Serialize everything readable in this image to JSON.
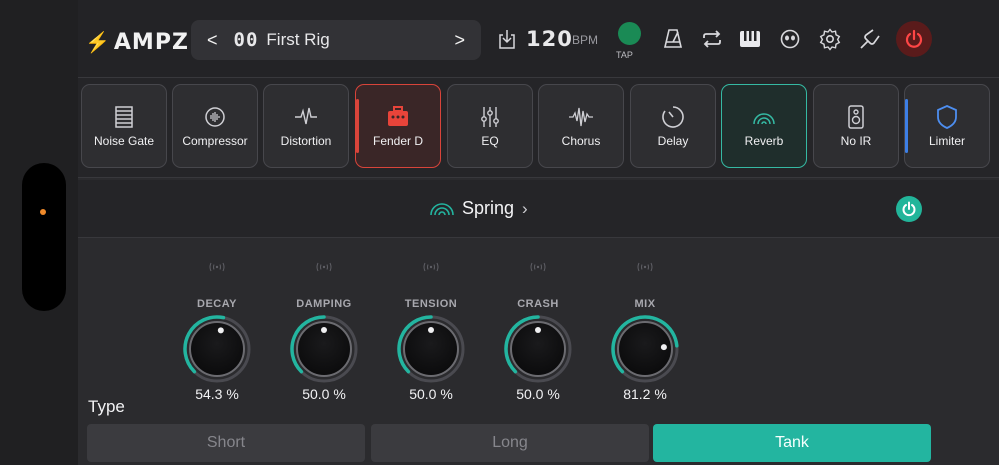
{
  "app": {
    "brand": "AMPZ"
  },
  "rig": {
    "prev_glyph": "<",
    "number": "00",
    "name": "First Rig",
    "next_glyph": ">"
  },
  "tempo": {
    "value": "120",
    "unit": "BPM",
    "tap_label": "TAP"
  },
  "toolbar_icons": [
    "metronome-icon",
    "loop-icon",
    "piano-icon",
    "tuner-face-icon",
    "settings-icon",
    "tuning-fork-icon",
    "power-icon"
  ],
  "modules": [
    {
      "label": "Noise Gate",
      "icon": "noise-gate-icon",
      "state": "normal"
    },
    {
      "label": "Compressor",
      "icon": "compressor-icon",
      "state": "normal"
    },
    {
      "label": "Distortion",
      "icon": "distortion-icon",
      "state": "normal"
    },
    {
      "label": "Fender D",
      "icon": "amp-icon",
      "state": "amp"
    },
    {
      "label": "EQ",
      "icon": "eq-icon",
      "state": "normal"
    },
    {
      "label": "Chorus",
      "icon": "chorus-icon",
      "state": "normal"
    },
    {
      "label": "Delay",
      "icon": "delay-icon",
      "state": "normal"
    },
    {
      "label": "Reverb",
      "icon": "reverb-icon",
      "state": "selected"
    },
    {
      "label": "No IR",
      "icon": "speaker-icon",
      "state": "normal"
    },
    {
      "label": "Limiter",
      "icon": "shield-icon",
      "state": "limiter"
    }
  ],
  "effect": {
    "name": "Spring",
    "arrow": "›"
  },
  "knobs": [
    {
      "label": "DECAY",
      "value_text": "54.3 %",
      "value": 0.543
    },
    {
      "label": "DAMPING",
      "value_text": "50.0 %",
      "value": 0.5
    },
    {
      "label": "TENSION",
      "value_text": "50.0 %",
      "value": 0.5
    },
    {
      "label": "CRASH",
      "value_text": "50.0 %",
      "value": 0.5
    },
    {
      "label": "MIX",
      "value_text": "81.2 %",
      "value": 0.812
    }
  ],
  "type": {
    "label": "Type",
    "options": [
      "Short",
      "Long",
      "Tank"
    ],
    "selected": "Tank"
  },
  "colors": {
    "accent": "#23b5a0",
    "brand_red": "#ff4646",
    "amp_red": "#d8443a",
    "limiter_blue": "#3d7fe6",
    "tap_green": "#1a8a55",
    "indicator_orange": "#f08a2a"
  }
}
